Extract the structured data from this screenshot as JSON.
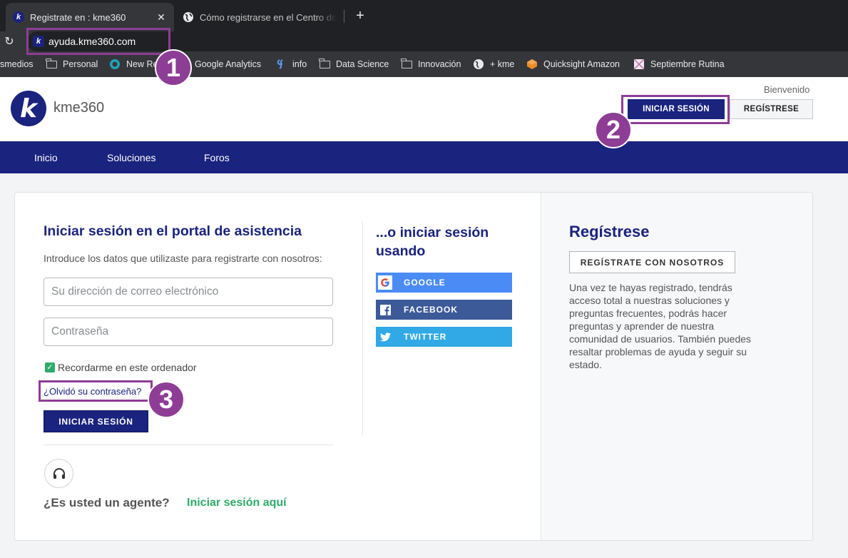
{
  "browser": {
    "tabs": [
      {
        "title": "Registrate en : kme360",
        "close": "✕"
      },
      {
        "title": "Cómo registrarse en el Centro de Ayuda"
      }
    ],
    "new_tab": "+",
    "address": "ayuda.kme360.com",
    "bookmarks": [
      "smedios",
      "Personal",
      "New Re",
      "Google Analytics",
      "info",
      "Data Science",
      "Innovación",
      "+ kme",
      "Quicksight Amazon",
      "Septiembre Rutina"
    ]
  },
  "badges": [
    "1",
    "2",
    "3"
  ],
  "header": {
    "logo_letter": "k",
    "brand": "kme360",
    "welcome": "Bienvenido",
    "login_label": "INICIAR SESIÓN",
    "register_label": "REGÍSTRESE"
  },
  "nav": [
    "Inicio",
    "Soluciones",
    "Foros"
  ],
  "login": {
    "title": "Iniciar sesión en el portal de asistencia",
    "description": "Introduce los datos que utilizaste para registrarte con nosotros:",
    "email_placeholder": "Su dirección de correo electrónico",
    "password_placeholder": "Contraseña",
    "remember_label": "Recordarme en este ordenador",
    "remember_checked": true,
    "forgot_link": "¿Olvidó su contraseña?",
    "submit_label": "INICIAR SESIÓN"
  },
  "agent": {
    "question": "¿Es usted un agente?",
    "link": "Iniciar sesión aquí"
  },
  "social": {
    "title": "...o iniciar sesión usando",
    "google": "GOOGLE",
    "facebook": "FACEBOOK",
    "twitter": "TWITTER"
  },
  "register": {
    "title": "Regístrese",
    "button": "REGÍSTRATE CON NOSOTROS",
    "text": "Una vez te hayas registrado, tendrás acceso total a nuestras soluciones y preguntas frecuentes, podrás hacer preguntas y aprender de nuestra comunidad de usuarios. También puedes resaltar problemas de ayuda y seguir su estado."
  },
  "colors": {
    "brand_navy": "#1a237e",
    "accent_green": "#2eaa6a",
    "highlight_purple": "#8e3d96",
    "google": "#4b8bf5",
    "facebook": "#3c5998",
    "twitter": "#30a9e6"
  }
}
